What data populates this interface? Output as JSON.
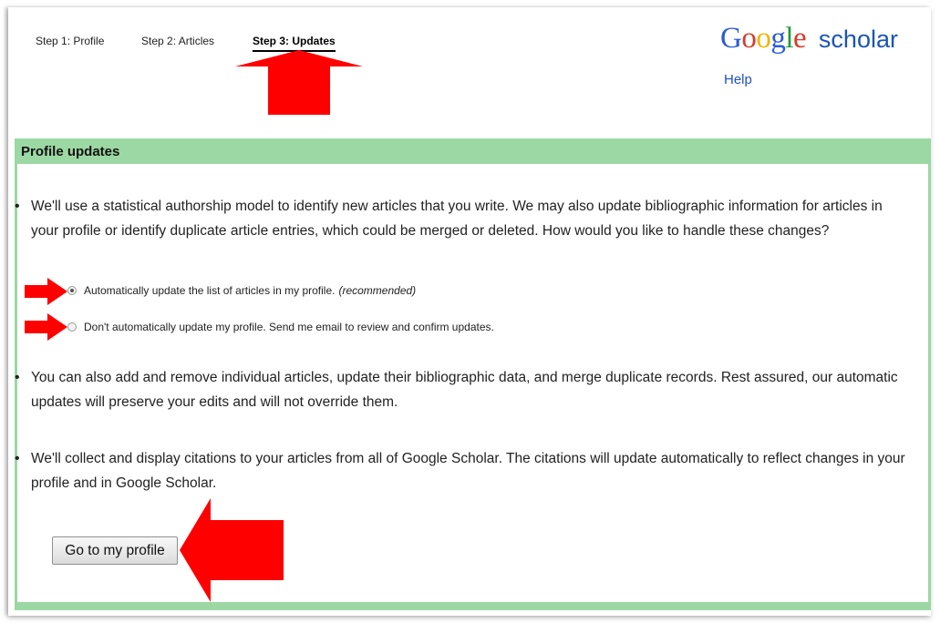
{
  "steps": {
    "step1": "Step 1: Profile",
    "step2": "Step 2: Articles",
    "step3": "Step 3: Updates",
    "active": "step3"
  },
  "logo": {
    "google_letters": [
      "G",
      "o",
      "o",
      "g",
      "l",
      "e"
    ],
    "google_colors": [
      "#2a5bd7",
      "#d73b2a",
      "#f0b400",
      "#2a5bd7",
      "#1f9a3a",
      "#d73b2a"
    ],
    "scholar": "scholar"
  },
  "help_link": "Help",
  "panel": {
    "title": "Profile updates",
    "bullet1": "We'll use a statistical authorship model to identify new articles that you write. We may also update bibliographic information for articles in your profile or identify duplicate article entries, which could be merged or deleted. How would you like to handle these changes?",
    "options": {
      "auto_label": "Automatically update the list of articles in my profile.",
      "auto_note": "(recommended)",
      "manual_label": "Don't automatically update my profile. Send me email to review and confirm updates.",
      "selected": "auto"
    },
    "bullet2": "You can also add and remove individual articles, update their bibliographic data, and merge duplicate records. Rest assured, our automatic updates will preserve your edits and will not override them.",
    "bullet3": "We'll collect and display citations to your articles from all of Google Scholar. The citations will update automatically to reflect changes in your profile and in Google Scholar.",
    "button": "Go to my profile"
  },
  "colors": {
    "panel_green": "#9cd8a3",
    "annotation_red": "#ff0000",
    "help_blue": "#2050c0"
  }
}
